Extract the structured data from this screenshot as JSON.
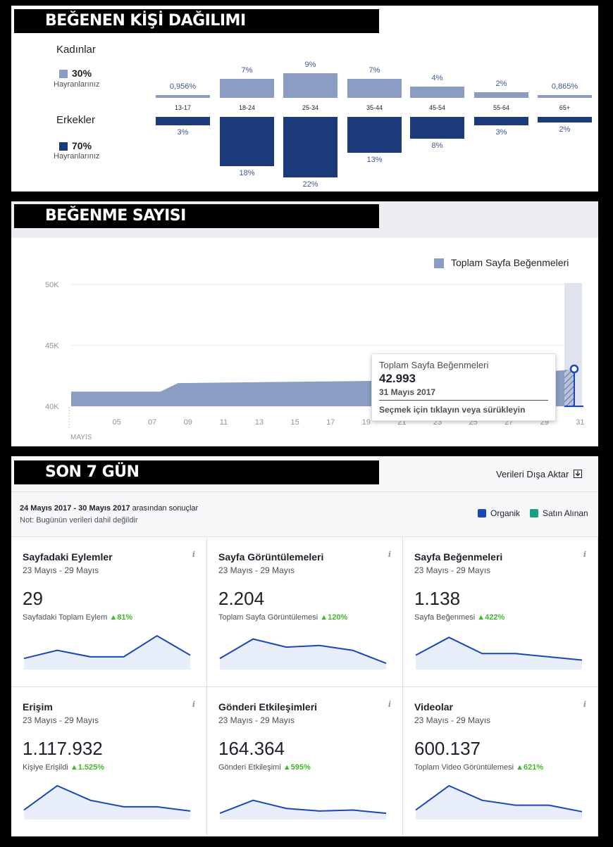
{
  "sections": {
    "demographics": {
      "title": "BEĞENEN KİŞİ DAĞILIMI",
      "female": {
        "label": "Kadınlar",
        "pct": "30%",
        "sub": "Hayranlarınız",
        "color": "#8b9dc3"
      },
      "male": {
        "label": "Erkekler",
        "pct": "70%",
        "sub": "Hayranlarınız",
        "color": "#1a3a7a"
      },
      "age_groups": [
        "13-17",
        "18-24",
        "25-34",
        "35-44",
        "45-54",
        "55-64",
        "65+"
      ],
      "female_labels": [
        "0,956%",
        "7%",
        "9%",
        "7%",
        "4%",
        "2%",
        "0,865%"
      ],
      "male_labels": [
        "3%",
        "18%",
        "22%",
        "13%",
        "8%",
        "3%",
        "2%"
      ]
    },
    "likes": {
      "title": "BEĞENME SAYISI",
      "legend": "Toplam Sayfa Beğenmeleri",
      "tooltip": {
        "title": "Toplam Sayfa Beğenmeleri",
        "value": "42.993",
        "date": "31 Mayıs 2017",
        "hint": "Seçmek için tıklayın veya sürükleyin"
      }
    },
    "last7": {
      "title": "SON 7 GÜN",
      "export": "Verileri Dışa Aktar",
      "results_range": "24 Mayıs 2017 - 30 Mayıs 2017",
      "results_suffix": "arasından sonuçlar",
      "note": "Not: Bugünün verileri dahil değildir",
      "legend_organic": "Organik",
      "legend_paid": "Satın Alınan",
      "color_organic": "#1a46b8",
      "color_paid": "#16a085",
      "cards": [
        {
          "title": "Sayfadaki Eylemler",
          "range": "23 Mayıs - 29 Mayıs",
          "value": "29",
          "sub": "Sayfadaki Toplam Eylem",
          "change": "▲81%",
          "spark": [
            0.3,
            0.55,
            0.35,
            0.35,
            1.0,
            0.4
          ]
        },
        {
          "title": "Sayfa Görüntülemeleri",
          "range": "23 Mayıs - 29 Mayıs",
          "value": "2.204",
          "sub": "Toplam Sayfa Görüntülemesi",
          "change": "▲120%",
          "spark": [
            0.3,
            0.9,
            0.65,
            0.7,
            0.55,
            0.15
          ]
        },
        {
          "title": "Sayfa Beğenmeleri",
          "range": "23 Mayıs - 29 Mayıs",
          "value": "1.138",
          "sub": "Sayfa Beğenmesi",
          "change": "▲422%",
          "spark": [
            0.4,
            0.95,
            0.45,
            0.45,
            0.35,
            0.25
          ]
        },
        {
          "title": "Erişim",
          "range": "23 Mayıs - 29 Mayıs",
          "value": "1.117.932",
          "sub": "Kişiye Erişildi",
          "change": "▲1.525%",
          "spark": [
            0.25,
            1.0,
            0.55,
            0.35,
            0.35,
            0.22
          ]
        },
        {
          "title": "Gönderi Etkileşimleri",
          "range": "23 Mayıs - 29 Mayıs",
          "value": "164.364",
          "sub": "Gönderi Etkileşimi",
          "change": "▲595%",
          "spark": [
            0.15,
            0.55,
            0.3,
            0.22,
            0.25,
            0.15
          ]
        },
        {
          "title": "Videolar",
          "range": "23 Mayıs - 29 Mayıs",
          "value": "600.137",
          "sub": "Toplam Video Görüntülemesi",
          "change": "▲621%",
          "spark": [
            0.25,
            1.0,
            0.55,
            0.4,
            0.4,
            0.2
          ]
        }
      ]
    }
  },
  "chart_data": [
    {
      "type": "bar",
      "title": "BEĞENEN KİŞİ DAĞILIMI",
      "categories": [
        "13-17",
        "18-24",
        "25-34",
        "35-44",
        "45-54",
        "55-64",
        "65+"
      ],
      "series": [
        {
          "name": "Kadınlar",
          "values": [
            0.956,
            7,
            9,
            7,
            4,
            2,
            0.865
          ]
        },
        {
          "name": "Erkekler",
          "values": [
            3,
            18,
            22,
            13,
            8,
            3,
            2
          ]
        }
      ]
    },
    {
      "type": "area",
      "title": "BEĞENME SAYISI",
      "series": [
        {
          "name": "Toplam Sayfa Beğenmeleri",
          "x": [
            3,
            8,
            9,
            21,
            29,
            31
          ],
          "values": [
            41200,
            41200,
            41900,
            42100,
            42800,
            42993
          ]
        }
      ],
      "yticks": [
        "50K",
        "45K",
        "40K"
      ],
      "xticks": [
        "05",
        "07",
        "09",
        "11",
        "13",
        "15",
        "17",
        "19",
        "21",
        "23",
        "25",
        "27",
        "29",
        "31"
      ],
      "xlabel": "MAYIS",
      "ylim": [
        40000,
        50000
      ]
    }
  ]
}
